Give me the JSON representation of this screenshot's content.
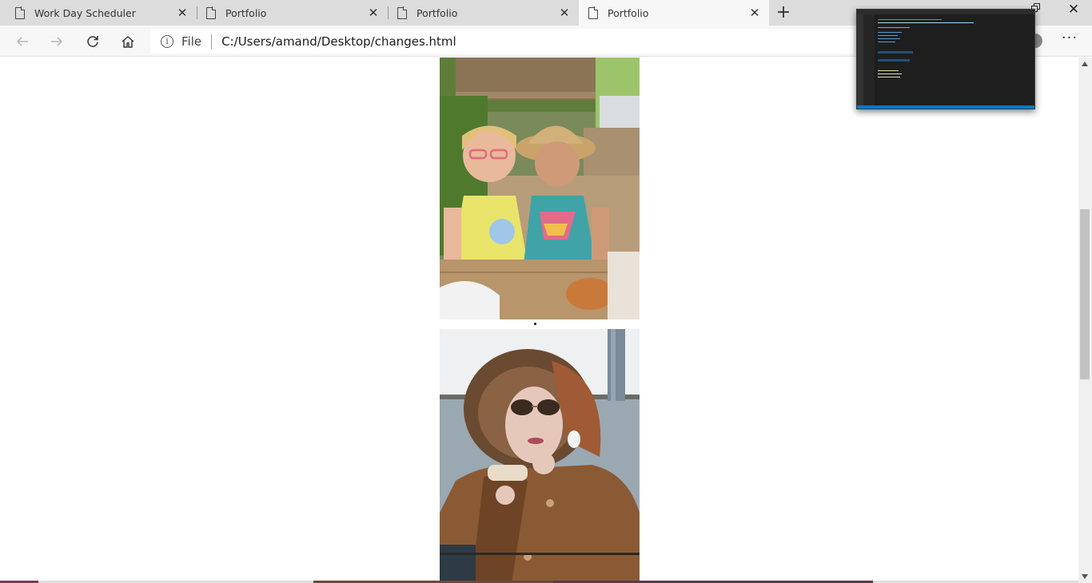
{
  "tabs": [
    {
      "title": "Work Day Scheduler",
      "active": false
    },
    {
      "title": "Portfolio",
      "active": false
    },
    {
      "title": "Portfolio",
      "active": false
    },
    {
      "title": "Portfolio",
      "active": true
    }
  ],
  "tab_close_glyph": "✕",
  "new_tab_glyph": "+",
  "window_close_glyph": "✕",
  "toolbar": {
    "back_icon": "back-arrow-icon",
    "forward_icon": "forward-arrow-icon",
    "refresh_icon": "refresh-icon",
    "home_icon": "home-icon",
    "more_glyph": "···"
  },
  "address_bar": {
    "info_glyph": "i",
    "scheme_label": "File",
    "url": "C:/Users/amand/Desktop/changes.html"
  },
  "content": {
    "images": [
      {
        "name": "two-girls-photo",
        "description_icon": "photo"
      },
      {
        "name": "woman-in-fur-hood-photo",
        "description_icon": "photo"
      }
    ]
  },
  "colors": {
    "tabstrip": "#dcdcdc",
    "active_tab": "#f7f7f7",
    "page_bg": "#ffffff",
    "editor_bg": "#1e1e1e",
    "editor_status": "#007acc"
  }
}
